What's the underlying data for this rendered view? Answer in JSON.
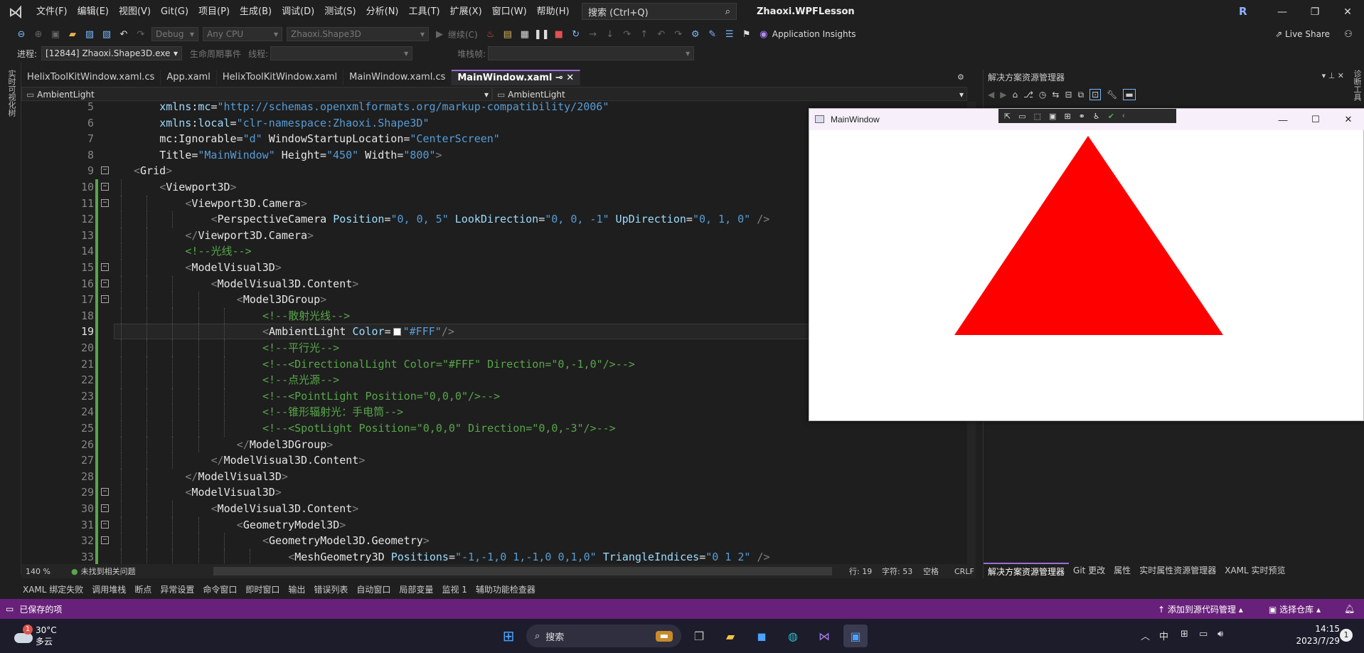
{
  "menu": [
    "文件(F)",
    "编辑(E)",
    "视图(V)",
    "Git(G)",
    "项目(P)",
    "生成(B)",
    "调试(D)",
    "测试(S)",
    "分析(N)",
    "工具(T)",
    "扩展(X)",
    "窗口(W)",
    "帮助(H)"
  ],
  "search_label": "搜索 (Ctrl+Q)",
  "solution_name": "Zhaoxi.WPFLesson",
  "user_initial": "R",
  "toolbar": {
    "config": "Debug",
    "platform": "Any CPU",
    "startup": "Zhaoxi.Shape3D",
    "continue": "继续(C)",
    "app_insights": "Application Insights",
    "live_share": "Live Share"
  },
  "toolbar2": {
    "process_label": "进程:",
    "process_value": "[12844] Zhaoxi.Shape3D.exe",
    "lifecycle": "生命周期事件",
    "thread_label": "线程:",
    "stack_label": "堆栈帧:"
  },
  "left_strip_text": "实时可视化树",
  "right_strip_text": "诊断工具",
  "tabs": [
    {
      "label": "HelixToolKitWindow.xaml.cs",
      "active": false
    },
    {
      "label": "App.xaml",
      "active": false
    },
    {
      "label": "HelixToolKitWindow.xaml",
      "active": false
    },
    {
      "label": "MainWindow.xaml.cs",
      "active": false
    },
    {
      "label": "MainWindow.xaml",
      "active": true
    }
  ],
  "nav": {
    "left": "AmbientLight",
    "right": "AmbientLight"
  },
  "code_lines": [
    {
      "n": "5",
      "indent": 4,
      "fold": false,
      "guides": 0,
      "tokens": [
        [
          "at",
          "xmlns"
        ],
        [
          "el",
          ":"
        ],
        [
          "at",
          "mc"
        ],
        [
          "el",
          "="
        ],
        [
          "val",
          "\"http://schemas.openxmlformats.org/markup-compatibility/2006\""
        ]
      ]
    },
    {
      "n": "6",
      "indent": 4,
      "fold": false,
      "guides": 0,
      "tokens": [
        [
          "at",
          "xmlns"
        ],
        [
          "el",
          ":"
        ],
        [
          "at",
          "local"
        ],
        [
          "el",
          "="
        ],
        [
          "val",
          "\"clr-namespace:Zhaoxi.Shape3D\""
        ]
      ]
    },
    {
      "n": "7",
      "indent": 4,
      "fold": false,
      "guides": 0,
      "tokens": [
        [
          "el",
          "mc"
        ],
        [
          "el",
          ":"
        ],
        [
          "el",
          "Ignorable"
        ],
        [
          "el",
          "="
        ],
        [
          "val",
          "\"d\""
        ],
        [
          "el",
          " WindowStartupLocation"
        ],
        [
          "el",
          "="
        ],
        [
          "val",
          "\"CenterScreen\""
        ]
      ]
    },
    {
      "n": "8",
      "indent": 4,
      "fold": false,
      "guides": 0,
      "tokens": [
        [
          "el",
          "Title"
        ],
        [
          "el",
          "="
        ],
        [
          "val",
          "\"MainWindow\""
        ],
        [
          "el",
          " Height"
        ],
        [
          "el",
          "="
        ],
        [
          "val",
          "\"450\""
        ],
        [
          "el",
          " Width"
        ],
        [
          "el",
          "="
        ],
        [
          "val",
          "\"800\""
        ],
        [
          "br",
          ">"
        ]
      ]
    },
    {
      "n": "9",
      "indent": 0,
      "fold": true,
      "guides": 0,
      "tokens": [
        [
          "br",
          "<"
        ],
        [
          "el",
          "Grid"
        ],
        [
          "br",
          ">"
        ]
      ]
    },
    {
      "n": "10",
      "indent": 4,
      "fold": true,
      "guides": 1,
      "tokens": [
        [
          "br",
          "<"
        ],
        [
          "el",
          "Viewport3D"
        ],
        [
          "br",
          ">"
        ]
      ]
    },
    {
      "n": "11",
      "indent": 8,
      "fold": true,
      "guides": 2,
      "tokens": [
        [
          "br",
          "<"
        ],
        [
          "el",
          "Viewport3D.Camera"
        ],
        [
          "br",
          ">"
        ]
      ]
    },
    {
      "n": "12",
      "indent": 12,
      "fold": false,
      "guides": 3,
      "tokens": [
        [
          "br",
          "<"
        ],
        [
          "el",
          "PerspectiveCamera "
        ],
        [
          "at",
          "Position"
        ],
        [
          "el",
          "="
        ],
        [
          "val",
          "\"0, 0, 5\""
        ],
        [
          "at",
          " LookDirection"
        ],
        [
          "el",
          "="
        ],
        [
          "val",
          "\"0, 0, -1\""
        ],
        [
          "at",
          " UpDirection"
        ],
        [
          "el",
          "="
        ],
        [
          "val",
          "\"0, 1, 0\""
        ],
        [
          "br",
          " />"
        ]
      ]
    },
    {
      "n": "13",
      "indent": 8,
      "fold": false,
      "guides": 2,
      "tokens": [
        [
          "br",
          "</"
        ],
        [
          "el",
          "Viewport3D.Camera"
        ],
        [
          "br",
          ">"
        ]
      ]
    },
    {
      "n": "14",
      "indent": 8,
      "fold": false,
      "guides": 2,
      "tokens": [
        [
          "cm",
          "<!--光线-->"
        ]
      ]
    },
    {
      "n": "15",
      "indent": 8,
      "fold": true,
      "guides": 2,
      "tokens": [
        [
          "br",
          "<"
        ],
        [
          "el",
          "ModelVisual3D"
        ],
        [
          "br",
          ">"
        ]
      ]
    },
    {
      "n": "16",
      "indent": 12,
      "fold": true,
      "guides": 3,
      "tokens": [
        [
          "br",
          "<"
        ],
        [
          "el",
          "ModelVisual3D.Content"
        ],
        [
          "br",
          ">"
        ]
      ]
    },
    {
      "n": "17",
      "indent": 16,
      "fold": true,
      "guides": 4,
      "tokens": [
        [
          "br",
          "<"
        ],
        [
          "el",
          "Model3DGroup"
        ],
        [
          "br",
          ">"
        ]
      ]
    },
    {
      "n": "18",
      "indent": 20,
      "fold": false,
      "guides": 5,
      "tokens": [
        [
          "cm",
          "<!--散射光线-->"
        ]
      ]
    },
    {
      "n": "19",
      "indent": 20,
      "fold": false,
      "guides": 5,
      "current": true,
      "tokens": [
        [
          "br",
          "<"
        ],
        [
          "el",
          "AmbientLight "
        ],
        [
          "at",
          "Color"
        ],
        [
          "el",
          "="
        ],
        [
          "swatch",
          ""
        ],
        [
          "val",
          "\"#FFF\""
        ],
        [
          "br",
          "/>"
        ]
      ]
    },
    {
      "n": "20",
      "indent": 20,
      "fold": false,
      "guides": 5,
      "tokens": [
        [
          "cm",
          "<!--平行光-->"
        ]
      ]
    },
    {
      "n": "21",
      "indent": 20,
      "fold": false,
      "guides": 5,
      "tokens": [
        [
          "cm",
          "<!--<DirectionalLight Color=\"#FFF\" Direction=\"0,-1,0\"/>-->"
        ]
      ]
    },
    {
      "n": "22",
      "indent": 20,
      "fold": false,
      "guides": 5,
      "tokens": [
        [
          "cm",
          "<!--点光源-->"
        ]
      ]
    },
    {
      "n": "23",
      "indent": 20,
      "fold": false,
      "guides": 5,
      "tokens": [
        [
          "cm",
          "<!--<PointLight Position=\"0,0,0\"/>-->"
        ]
      ]
    },
    {
      "n": "24",
      "indent": 20,
      "fold": false,
      "guides": 5,
      "tokens": [
        [
          "cm",
          "<!--锥形辐射光：手电筒-->"
        ]
      ]
    },
    {
      "n": "25",
      "indent": 20,
      "fold": false,
      "guides": 5,
      "tokens": [
        [
          "cm",
          "<!--<SpotLight Position=\"0,0,0\" Direction=\"0,0,-3\"/>-->"
        ]
      ]
    },
    {
      "n": "26",
      "indent": 16,
      "fold": false,
      "guides": 4,
      "tokens": [
        [
          "br",
          "</"
        ],
        [
          "el",
          "Model3DGroup"
        ],
        [
          "br",
          ">"
        ]
      ]
    },
    {
      "n": "27",
      "indent": 12,
      "fold": false,
      "guides": 3,
      "tokens": [
        [
          "br",
          "</"
        ],
        [
          "el",
          "ModelVisual3D.Content"
        ],
        [
          "br",
          ">"
        ]
      ]
    },
    {
      "n": "28",
      "indent": 8,
      "fold": false,
      "guides": 2,
      "tokens": [
        [
          "br",
          "</"
        ],
        [
          "el",
          "ModelVisual3D"
        ],
        [
          "br",
          ">"
        ]
      ]
    },
    {
      "n": "29",
      "indent": 8,
      "fold": true,
      "guides": 2,
      "tokens": [
        [
          "br",
          "<"
        ],
        [
          "el",
          "ModelVisual3D"
        ],
        [
          "br",
          ">"
        ]
      ]
    },
    {
      "n": "30",
      "indent": 12,
      "fold": true,
      "guides": 3,
      "tokens": [
        [
          "br",
          "<"
        ],
        [
          "el",
          "ModelVisual3D.Content"
        ],
        [
          "br",
          ">"
        ]
      ]
    },
    {
      "n": "31",
      "indent": 16,
      "fold": true,
      "guides": 4,
      "tokens": [
        [
          "br",
          "<"
        ],
        [
          "el",
          "GeometryModel3D"
        ],
        [
          "br",
          ">"
        ]
      ]
    },
    {
      "n": "32",
      "indent": 20,
      "fold": true,
      "guides": 5,
      "tokens": [
        [
          "br",
          "<"
        ],
        [
          "el",
          "GeometryModel3D.Geometry"
        ],
        [
          "br",
          ">"
        ]
      ]
    },
    {
      "n": "33",
      "indent": 24,
      "fold": false,
      "guides": 6,
      "tokens": [
        [
          "br",
          "<"
        ],
        [
          "el",
          "MeshGeometry3D "
        ],
        [
          "at",
          "Positions"
        ],
        [
          "el",
          "="
        ],
        [
          "val",
          "\"-1,-1,0 1,-1,0 0,1,0\""
        ],
        [
          "at",
          " TriangleIndices"
        ],
        [
          "el",
          "="
        ],
        [
          "val",
          "\"0 1 2\""
        ],
        [
          "br",
          " />"
        ]
      ]
    }
  ],
  "editor_status": {
    "zoom": "140 %",
    "issues": "未找到相关问题",
    "line": "行: 19",
    "col": "字符: 53",
    "spaces": "空格",
    "eol": "CRLF"
  },
  "tool_windows": [
    "XAML 绑定失败",
    "调用堆栈",
    "断点",
    "异常设置",
    "命令窗口",
    "即时窗口",
    "输出",
    "错误列表",
    "自动窗口",
    "局部变量",
    "监视 1",
    "辅助功能检查器"
  ],
  "status": {
    "saved": "已保存的项",
    "add_source": "添加到源代码管理",
    "select_repo": "选择仓库"
  },
  "right_panel": {
    "title": "解决方案资源管理器",
    "tabs": [
      "解决方案资源管理器",
      "Git 更改",
      "属性",
      "实时属性资源管理器",
      "XAML 实时预览"
    ]
  },
  "wpf_window": {
    "title": "MainWindow",
    "triangle_color": "#ff0000",
    "background": "#ffffff"
  },
  "taskbar": {
    "temp": "30°C",
    "weather": "多云",
    "weather_badge": "1",
    "search": "搜索",
    "ime": "中",
    "time": "14:15",
    "date": "2023/7/29",
    "notif": "1"
  }
}
